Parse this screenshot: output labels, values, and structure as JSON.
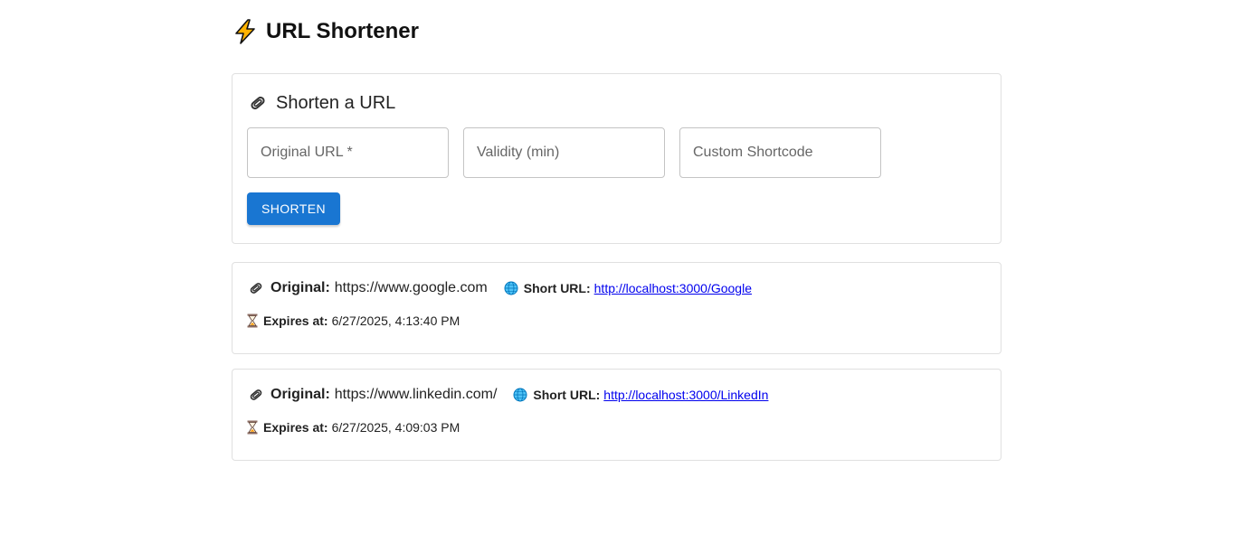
{
  "header": {
    "title": "URL Shortener",
    "icon": "lightning-icon"
  },
  "form": {
    "title": "Shorten a URL",
    "icon": "paperclip-icon",
    "original_url_placeholder": "Original URL *",
    "validity_placeholder": "Validity (min)",
    "shortcode_placeholder": "Custom Shortcode",
    "submit_label": "SHORTEN",
    "accent_color": "#1976d2"
  },
  "results": [
    {
      "original_label": "Original:",
      "original_url": "https://www.google.com",
      "short_label": "Short URL:",
      "short_url": "http://localhost:3000/Google",
      "expires_label": "Expires at:",
      "expires_at": "6/27/2025, 4:13:40 PM"
    },
    {
      "original_label": "Original:",
      "original_url": "https://www.linkedin.com/",
      "short_label": "Short URL:",
      "short_url": "http://localhost:3000/LinkedIn",
      "expires_label": "Expires at:",
      "expires_at": "6/27/2025, 4:09:03 PM"
    }
  ],
  "colors": {
    "link": "#0000ee",
    "border": "#e0e0e0"
  }
}
